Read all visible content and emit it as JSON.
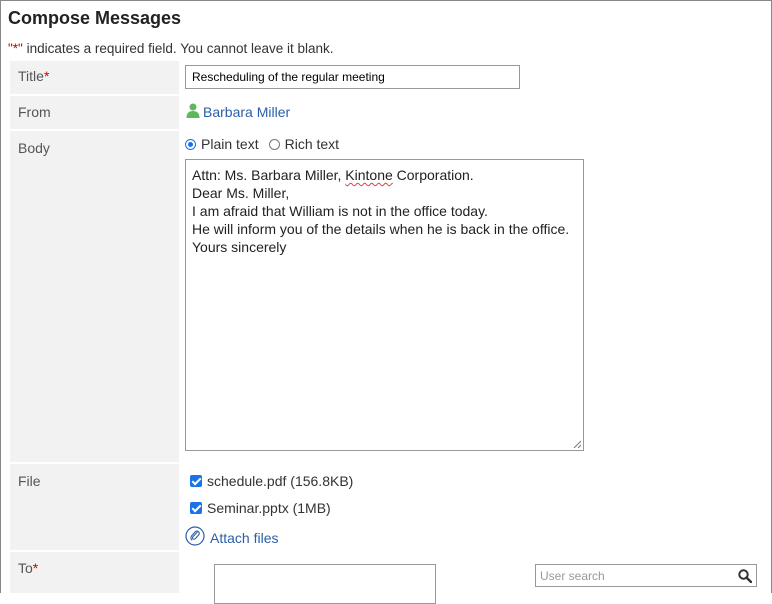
{
  "page": {
    "title": "Compose Messages"
  },
  "required_note": {
    "mark": "\"*\"",
    "text": " indicates a required field. You cannot leave it blank."
  },
  "fields": {
    "title": {
      "label": "Title",
      "required_mark": "*",
      "value": "Rescheduling of the regular meeting"
    },
    "from": {
      "label": "From",
      "user_name": "Barbara Miller"
    },
    "body": {
      "label": "Body",
      "format_options": [
        {
          "label": "Plain text",
          "selected": true
        },
        {
          "label": "Rich text",
          "selected": false
        }
      ],
      "line1_prefix": "Attn: Ms. Barbara Miller, ",
      "line1_misspelled": "Kintone",
      "line1_suffix": " Corporation.",
      "rest": "\nDear Ms. Miller,\nI am afraid that William is not in the office today.\nHe will inform you of the details when he is back in the office.\nYours sincerely"
    },
    "file": {
      "label": "File",
      "files": [
        {
          "name": "schedule.pdf (156.8KB)",
          "checked": true
        },
        {
          "name": "Seminar.pptx (1MB)",
          "checked": true
        }
      ],
      "attach_label": "Attach files"
    },
    "to": {
      "label": "To",
      "required_mark": "*",
      "search_placeholder": "User search"
    }
  },
  "icons": {
    "user": "user-icon",
    "attach": "paperclip-icon",
    "search": "magnifier-icon",
    "resize": "resize-grip-icon"
  },
  "colors": {
    "link": "#2a5ea8",
    "required": "#cc0000",
    "check": "#1a73e8",
    "user_icon": "#5cb85c"
  }
}
